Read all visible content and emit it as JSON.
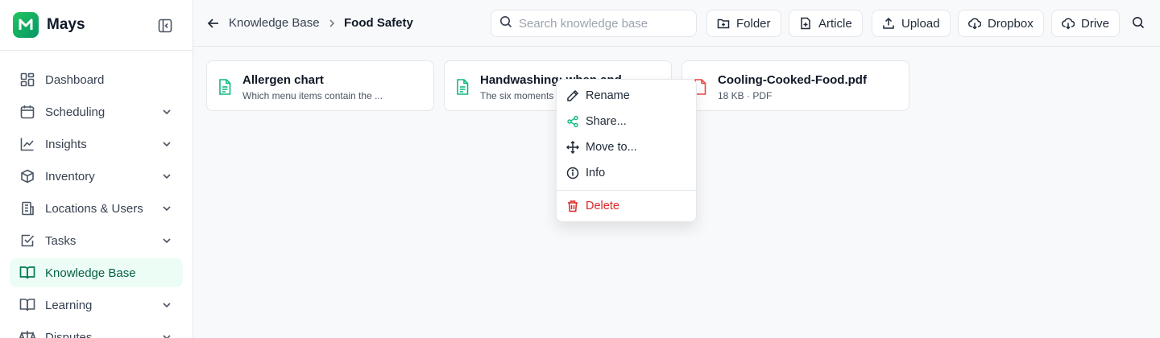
{
  "app": {
    "name": "Mays"
  },
  "sidebar": {
    "items": [
      {
        "label": "Dashboard",
        "icon": "grid-icon",
        "expandable": false
      },
      {
        "label": "Scheduling",
        "icon": "calendar-icon",
        "expandable": true
      },
      {
        "label": "Insights",
        "icon": "line-chart-icon",
        "expandable": true
      },
      {
        "label": "Inventory",
        "icon": "package-icon",
        "expandable": true
      },
      {
        "label": "Locations & Users",
        "icon": "building-icon",
        "expandable": true
      },
      {
        "label": "Tasks",
        "icon": "checkbox-icon",
        "expandable": true
      },
      {
        "label": "Knowledge Base",
        "icon": "book-open-icon",
        "expandable": false,
        "active": true
      },
      {
        "label": "Learning",
        "icon": "book-icon",
        "expandable": true
      },
      {
        "label": "Disputes",
        "icon": "scale-icon",
        "expandable": true
      }
    ]
  },
  "header": {
    "breadcrumb": [
      "Knowledge Base",
      "Food Safety"
    ],
    "search_placeholder": "Search knowledge base",
    "buttons": {
      "folder": "Folder",
      "article": "Article",
      "upload": "Upload",
      "dropbox": "Dropbox",
      "drive": "Drive"
    }
  },
  "cards": [
    {
      "title": "Allergen chart",
      "subtitle": "Which menu items contain the ...",
      "type": "article"
    },
    {
      "title": "Handwashing: when and",
      "subtitle": "The six moments",
      "type": "article"
    },
    {
      "title": "Cooling-Cooked-Food.pdf",
      "subtitle": "18 KB · PDF",
      "type": "pdf"
    }
  ],
  "context_menu": {
    "rename": "Rename",
    "share": "Share...",
    "move": "Move to...",
    "info": "Info",
    "delete": "Delete"
  },
  "colors": {
    "brand": "#10b981",
    "active_bg": "#ecfdf5",
    "danger": "#dc2626",
    "pdf": "#ef4444"
  }
}
